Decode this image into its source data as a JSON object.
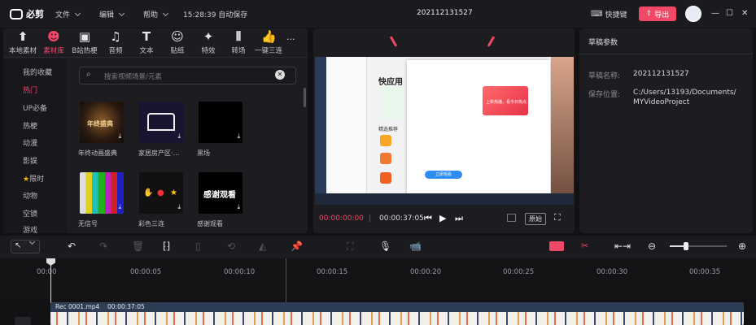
{
  "app": {
    "name": "必剪",
    "menus": [
      "文件",
      "编辑",
      "帮助"
    ],
    "autosave": "15:28:39 自动保存",
    "project_title": "202112131527",
    "shortcut_label": "快捷键",
    "export_label": "导出",
    "brand_color": "#f04866"
  },
  "tools": [
    {
      "label": "本地素材",
      "icon": "upload-icon"
    },
    {
      "label": "素材库",
      "icon": "bili-face-icon",
      "active": true
    },
    {
      "label": "B站热梗",
      "icon": "tv-face-icon"
    },
    {
      "label": "音频",
      "icon": "music-note-icon"
    },
    {
      "label": "文本",
      "icon": "text-t-icon"
    },
    {
      "label": "贴纸",
      "icon": "sticker-icon"
    },
    {
      "label": "特效",
      "icon": "sparkle-icon"
    },
    {
      "label": "转场",
      "icon": "transition-icon"
    },
    {
      "label": "一键三连",
      "icon": "thumbs-up-icon"
    }
  ],
  "categories": [
    {
      "label": "我的收藏"
    },
    {
      "label": "热门",
      "active": true
    },
    {
      "label": "UP必备"
    },
    {
      "label": "热梗"
    },
    {
      "label": "动漫"
    },
    {
      "label": "影娱"
    },
    {
      "label": "限时",
      "star": true
    },
    {
      "label": "动物"
    },
    {
      "label": "空镜"
    },
    {
      "label": "游戏"
    }
  ],
  "search": {
    "placeholder": "搜索视频场景/元素"
  },
  "assets": [
    {
      "label": "年终动画盛典"
    },
    {
      "label": "家居房产区·..."
    },
    {
      "label": "黑场"
    },
    {
      "label": "无信号"
    },
    {
      "label": "彩色三连"
    },
    {
      "label": "感谢观看"
    }
  ],
  "player": {
    "current": "00:00:00:00",
    "total": "00:00:37:05",
    "ratio_label": "原始"
  },
  "preview": {
    "heading": "快应用",
    "sub": "精选推荐",
    "banner": "上新热播，看今日热点",
    "button": "立即观看"
  },
  "draft": {
    "title": "草稿参数",
    "name_label": "草稿名称:",
    "name_value": "202112131527",
    "path_label": "保存位置:",
    "path_line1": "C:/Users/13193/Documents/",
    "path_line2": "MYVideoProject"
  },
  "ruler": [
    "00:00",
    "00:00:05",
    "00:00:10",
    "00:00:15",
    "00:00:20",
    "00:00:25",
    "00:00:30",
    "00:00:35"
  ],
  "clip": {
    "name": "Rec 0001.mp4",
    "duration": "00:00:37:05"
  }
}
